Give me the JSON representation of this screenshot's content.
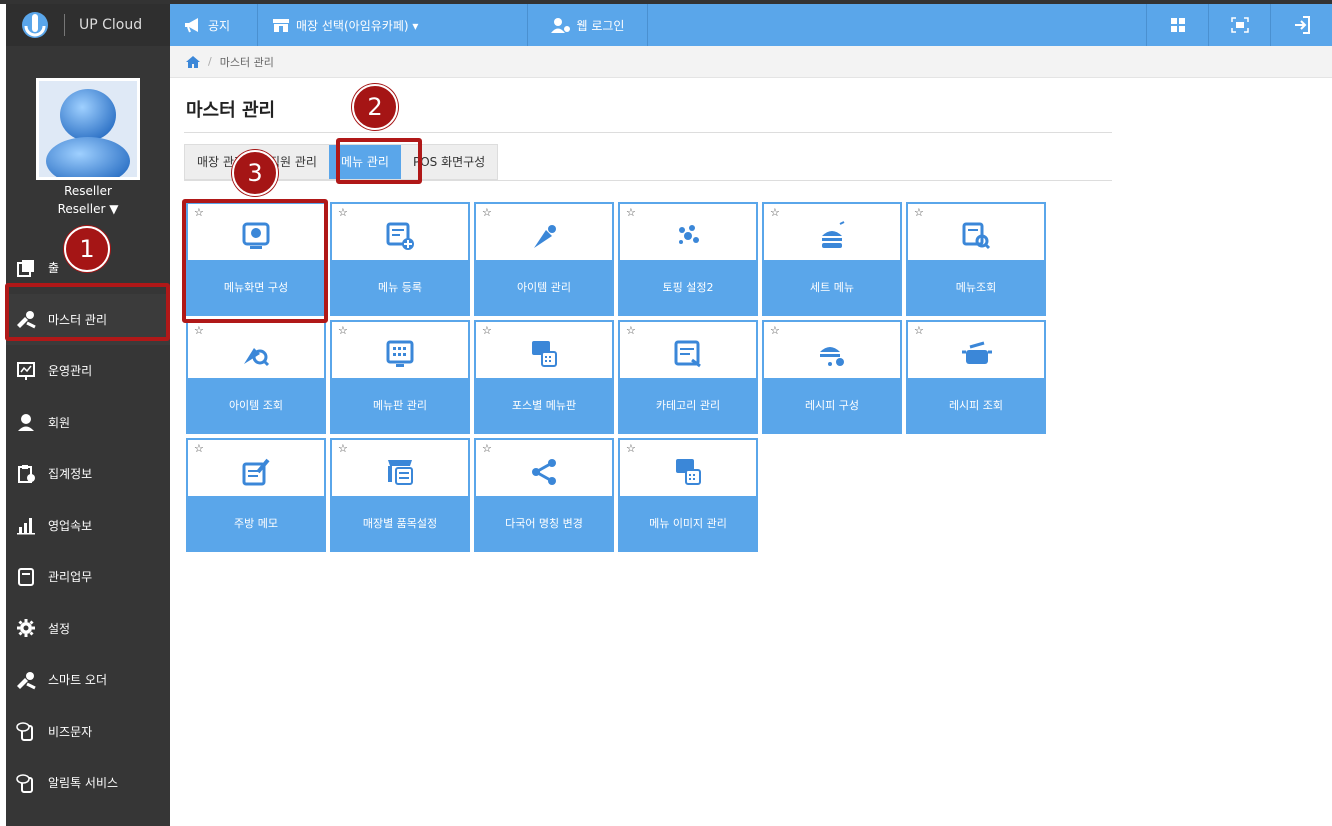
{
  "brand": {
    "name": "UP Cloud"
  },
  "topbar": {
    "notice": "공지",
    "store_select": "매장 선택(아임유카페) ▾",
    "web_login": "웹 로그인"
  },
  "breadcrumb": {
    "current": "마스터 관리",
    "separator": "/"
  },
  "user": {
    "name": "Reseller",
    "role": "Reseller ▼"
  },
  "sidebar": {
    "items": [
      {
        "label": "출",
        "icon": "copy-icon"
      },
      {
        "label": "마스터 관리",
        "icon": "tools-icon"
      },
      {
        "label": "운영관리",
        "icon": "chart-board-icon"
      },
      {
        "label": "회원",
        "icon": "user-icon"
      },
      {
        "label": "집계정보",
        "icon": "clipboard-icon"
      },
      {
        "label": "영업속보",
        "icon": "bar-chart-icon"
      },
      {
        "label": "관리업무",
        "icon": "notebook-icon"
      },
      {
        "label": "설정",
        "icon": "gear-icon"
      },
      {
        "label": "스마트 오더",
        "icon": "tools-icon"
      },
      {
        "label": "비즈문자",
        "icon": "message-phone-icon"
      },
      {
        "label": "알림톡 서비스",
        "icon": "message-phone-icon"
      }
    ]
  },
  "page": {
    "title": "마스터 관리"
  },
  "tabs": [
    "매장 관리",
    "직원 관리",
    "메뉴 관리",
    "POS 화면구성"
  ],
  "tiles": [
    {
      "label": "메뉴화면 구성",
      "icon": "screen-config-icon",
      "star": "☆"
    },
    {
      "label": "메뉴 등록",
      "icon": "menu-add-icon",
      "star": "☆"
    },
    {
      "label": "아이템 관리",
      "icon": "item-manage-icon",
      "star": "☆"
    },
    {
      "label": "토핑 설정2",
      "icon": "topping-icon",
      "star": "☆"
    },
    {
      "label": "세트 메뉴",
      "icon": "set-menu-icon",
      "star": "☆"
    },
    {
      "label": "메뉴조회",
      "icon": "menu-search-icon",
      "star": "☆"
    },
    {
      "label": "아이템 조회",
      "icon": "item-search-icon",
      "star": "☆"
    },
    {
      "label": "메뉴판 관리",
      "icon": "menuboard-icon",
      "star": "☆"
    },
    {
      "label": "포스별 메뉴판",
      "icon": "pos-menu-icon",
      "star": "☆"
    },
    {
      "label": "카테고리 관리",
      "icon": "category-icon",
      "star": "☆"
    },
    {
      "label": "레시피 구성",
      "icon": "recipe-config-icon",
      "star": "☆"
    },
    {
      "label": "레시피 조회",
      "icon": "recipe-search-icon",
      "star": "☆"
    },
    {
      "label": "주방 메모",
      "icon": "kitchen-memo-icon",
      "star": "☆"
    },
    {
      "label": "매장별 품목설정",
      "icon": "store-item-icon",
      "star": "☆"
    },
    {
      "label": "다국어 명칭 변경",
      "icon": "share-icon",
      "star": "☆"
    },
    {
      "label": "메뉴 이미지 관리",
      "icon": "menu-image-icon",
      "star": "☆"
    }
  ],
  "callouts": [
    "1",
    "2",
    "3"
  ],
  "colors": {
    "accent": "#5aa6ea",
    "sidebar": "#363636",
    "highlight": "#b01818"
  }
}
